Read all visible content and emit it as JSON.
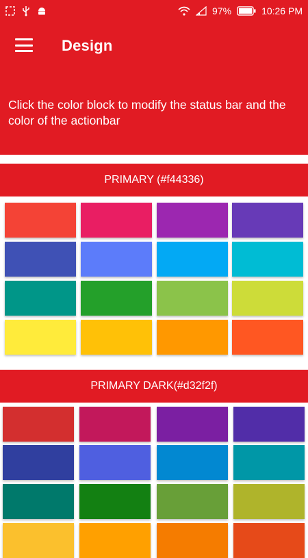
{
  "status_bar": {
    "battery_percent": "97%",
    "time": "10:26 PM",
    "icons": [
      "screenshot-icon",
      "usb-icon",
      "android-icon",
      "wifi-icon",
      "signal-icon",
      "battery-icon"
    ]
  },
  "app_bar": {
    "title": "Design",
    "menu_icon": "hamburger-menu-icon",
    "background": "#e11b23"
  },
  "description": "Click the color block to modify the status bar and the color of the actionbar",
  "sections": [
    {
      "title": "PRIMARY (#f44336)",
      "colors": [
        "#f44336",
        "#e91e63",
        "#9c27b0",
        "#673ab7",
        "#3f51b5",
        "#5c7cfa",
        "#03a9f4",
        "#00bcd4",
        "#009688",
        "#24a02a",
        "#8bc34a",
        "#cddc39",
        "#ffeb3b",
        "#ffc107",
        "#ff9800",
        "#ff5722"
      ]
    },
    {
      "title": "PRIMARY DARK(#d32f2f)",
      "colors": [
        "#d32f2f",
        "#c2185b",
        "#7b1fa2",
        "#512da8",
        "#303f9f",
        "#4f5fe0",
        "#0288d1",
        "#0097a7",
        "#00796b",
        "#138012",
        "#689f38",
        "#afb42b",
        "#fbc02d",
        "#ffa000",
        "#f57c00",
        "#e64a19"
      ]
    }
  ]
}
